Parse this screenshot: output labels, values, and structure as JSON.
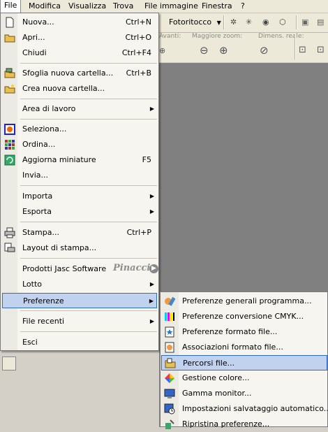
{
  "menubar": {
    "items": [
      "File",
      "Modifica",
      "Visualizza",
      "Trova",
      "File immagine",
      "Finestra",
      "?"
    ]
  },
  "toolbar": {
    "fotoritocco": "Fotoritocco",
    "labels": {
      "avanti": "Avanti:",
      "maggiore_zoom": "Maggiore zoom:",
      "dimens_reale": "Dimens. reale:"
    }
  },
  "menu": {
    "items": [
      {
        "label": "Nuova...",
        "shortcut": "Ctrl+N",
        "icon": "new-file-icon"
      },
      {
        "label": "Apri...",
        "shortcut": "Ctrl+O",
        "icon": "open-folder-icon"
      },
      {
        "label": "Chiudi",
        "shortcut": "Ctrl+F4"
      },
      {
        "label": "Sfoglia nuova cartella...",
        "shortcut": "Ctrl+B",
        "icon": "browse-folder-icon"
      },
      {
        "label": "Crea nuova cartella...",
        "icon": "new-folder-icon"
      },
      {
        "label": "Area di lavoro",
        "submenu": true
      },
      {
        "label": "Seleziona...",
        "icon": "select-icon"
      },
      {
        "label": "Ordina...",
        "icon": "sort-icon"
      },
      {
        "label": "Aggiorna miniature",
        "shortcut": "F5",
        "icon": "refresh-icon"
      },
      {
        "label": "Invia..."
      },
      {
        "label": "Importa",
        "submenu": true
      },
      {
        "label": "Esporta",
        "submenu": true
      },
      {
        "label": "Stampa...",
        "shortcut": "Ctrl+P",
        "icon": "print-icon"
      },
      {
        "label": "Layout di stampa...",
        "icon": "print-layout-icon"
      },
      {
        "label": "Prodotti Jasc Software"
      },
      {
        "label": "Lotto",
        "submenu": true
      },
      {
        "label": "Preferenze",
        "submenu": true
      },
      {
        "label": "File recenti",
        "submenu": true
      },
      {
        "label": "Esci"
      }
    ]
  },
  "submenu": {
    "items": [
      {
        "label": "Preferenze generali programma...",
        "icon": "general-prefs-icon"
      },
      {
        "label": "Preferenze conversione CMYK...",
        "icon": "cmyk-icon"
      },
      {
        "label": "Preferenze formato file...",
        "icon": "file-format-icon"
      },
      {
        "label": "Associazioni formato file...",
        "icon": "file-assoc-icon"
      },
      {
        "label": "Percorsi file...",
        "icon": "file-paths-icon"
      },
      {
        "label": "Gestione colore...",
        "icon": "color-management-icon"
      },
      {
        "label": "Gamma monitor...",
        "icon": "monitor-gamma-icon"
      },
      {
        "label": "Impostazioni salvataggio automatico...",
        "icon": "autosave-icon"
      },
      {
        "label": "Ripristina preferenze...",
        "icon": "reset-prefs-icon"
      }
    ]
  },
  "watermark": "Pinacci"
}
